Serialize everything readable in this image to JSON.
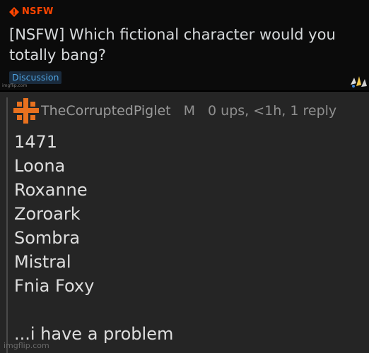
{
  "post": {
    "nsfw_label": "NSFW",
    "title": "[NSFW] Which fictional character would you totally bang?",
    "flair": "Discussion",
    "watermark": "imgflip.com"
  },
  "comment": {
    "username": "TheCorruptedPiglet",
    "mod_flag": "M",
    "meta": "0 ups, <1h, 1 reply",
    "lines": [
      "1471",
      "Loona",
      "Roxanne",
      "Zoroark",
      "Sombra",
      "Mistral",
      "Fnia Foxy"
    ],
    "closing": "...i have a problem",
    "watermark": "imgflip.com"
  },
  "icons": {
    "nsfw": "nsfw-diamond-icon",
    "avatar": "user-avatar-icon"
  },
  "colors": {
    "accent": "#ff4500",
    "flair_text": "#4fa3e0",
    "avatar": "#e8711f"
  }
}
